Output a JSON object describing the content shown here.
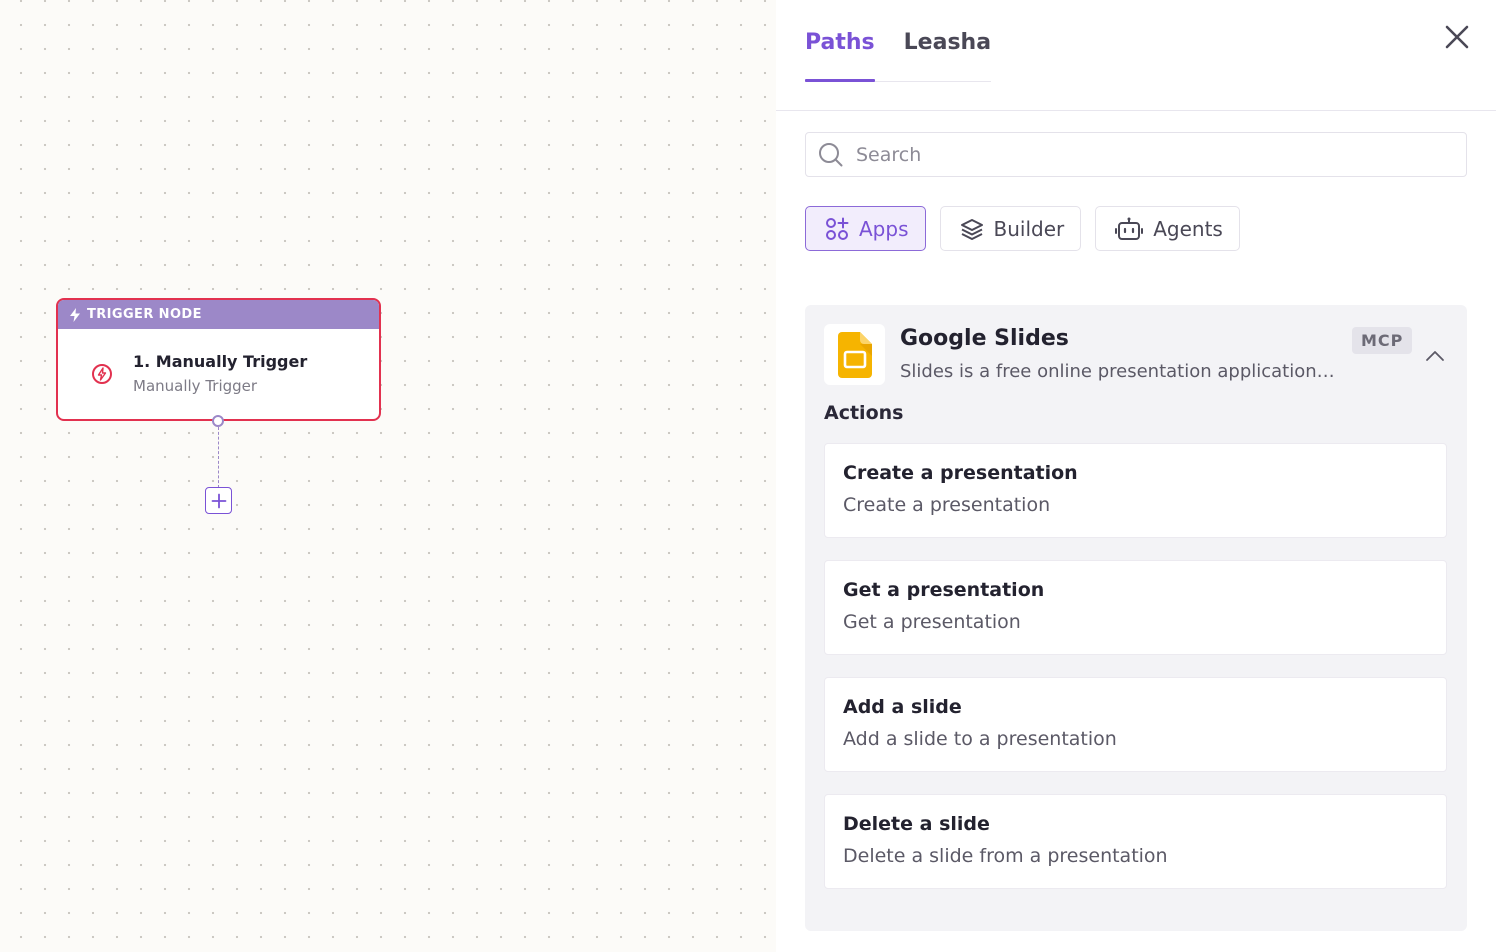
{
  "canvas": {
    "trigger_node": {
      "header": "TRIGGER NODE",
      "title": "1. Manually Trigger",
      "subtitle": "Manually Trigger",
      "border_color": "#e2314f",
      "header_color": "#9c88c8",
      "icon": "lightning-circle-icon"
    },
    "add_button_icon": "plus-icon"
  },
  "panel": {
    "tabs": [
      {
        "label": "Paths",
        "active": true
      },
      {
        "label": "Leasha",
        "active": false
      }
    ],
    "close_icon": "close-icon",
    "search": {
      "placeholder": "Search",
      "value": ""
    },
    "filters": [
      {
        "label": "Apps",
        "icon": "apps-grid-icon",
        "active": true
      },
      {
        "label": "Builder",
        "icon": "layers-icon",
        "active": false
      },
      {
        "label": "Agents",
        "icon": "robot-icon",
        "active": false
      }
    ],
    "app": {
      "name": "Google Slides",
      "description": "Slides is a free online presentation application…",
      "badge": "MCP",
      "logo_color": "#f6b400",
      "expanded": true,
      "actions_heading": "Actions",
      "actions": [
        {
          "title": "Create a presentation",
          "description": "Create a presentation"
        },
        {
          "title": "Get a presentation",
          "description": "Get a presentation"
        },
        {
          "title": "Add a slide",
          "description": "Add a slide to a presentation"
        },
        {
          "title": "Delete a slide",
          "description": "Delete a slide from a presentation"
        }
      ]
    }
  },
  "colors": {
    "accent": "#7a52d6",
    "accent_bg": "#f2edfc",
    "danger": "#e2314f",
    "card_bg": "#f3f3f6"
  }
}
